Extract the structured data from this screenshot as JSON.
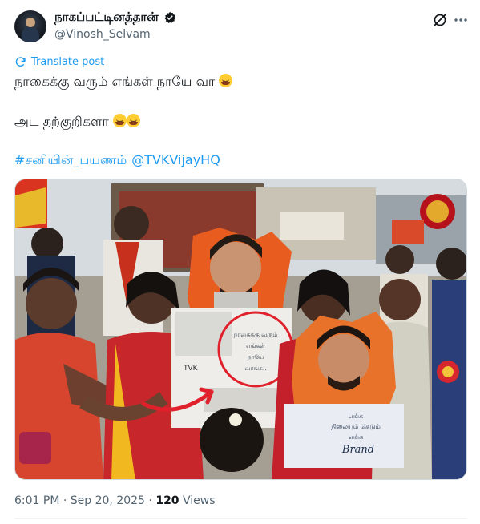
{
  "author": {
    "display_name": "நாகப்பட்டினத்தான்",
    "handle": "@Vinosh_Selvam"
  },
  "translate": {
    "label": "Translate post"
  },
  "post": {
    "line1": "நாகைக்கு வரும் எங்கள் நாயே வா",
    "line2": "அட தற்குறிகளா",
    "hashtag": "#சனியின்_பயணம்",
    "mention": "@TVKVijayHQ"
  },
  "media": {
    "sign_center_text": [
      "நாகைக்கு வரும்",
      "எங்கள்",
      "நாயே",
      "வாங்க.."
    ],
    "sign_right_text": [
      "எங்க",
      "நிலையும் கெடும்",
      "எங்க",
      "Brand"
    ],
    "sign_tvk_label": "TVK"
  },
  "footer": {
    "time": "6:01 PM",
    "separator1": "·",
    "date": "Sep 20, 2025",
    "separator2": "·",
    "views_count": "120",
    "views_label": "Views"
  },
  "colors": {
    "link": "#1d9bf0",
    "secondary_text": "#536471",
    "highlight_circle": "#e0202a"
  },
  "icons": [
    "verified-icon",
    "grok-icon",
    "more-icon",
    "translate-icon"
  ]
}
